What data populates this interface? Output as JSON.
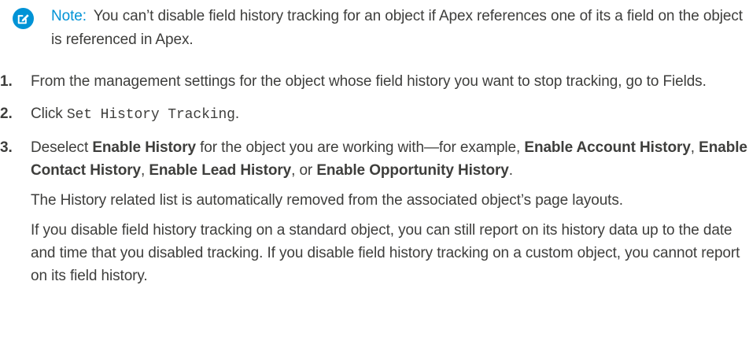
{
  "note": {
    "icon": "edit-note-icon",
    "icon_color": "#0093d6",
    "label": "Note:",
    "text": "You can’t disable field history tracking for an object if Apex references one of its a field on the object is referenced in Apex."
  },
  "steps": [
    {
      "number": "1.",
      "text": "From the management settings for the object whose field history you want to stop tracking, go to Fields."
    },
    {
      "number": "2.",
      "prefix": "Click ",
      "code": "Set History Tracking",
      "suffix": "."
    },
    {
      "number": "3.",
      "t1": "Deselect ",
      "b1": "Enable History",
      "t2": " for the object you are working with—for example, ",
      "b2": "Enable Account History",
      "t3": ", ",
      "b3": "Enable Contact History",
      "t4": ", ",
      "b4": "Enable Lead History",
      "t5": ", or ",
      "b5": "Enable Opportunity History",
      "t6": ".",
      "para1": "The History related list is automatically removed from the associated object’s page layouts.",
      "para2": "If you disable field history tracking on a standard object, you can still report on its history data up to the date and time that you disabled tracking. If you disable field history tracking on a custom object, you cannot report on its field history."
    }
  ]
}
